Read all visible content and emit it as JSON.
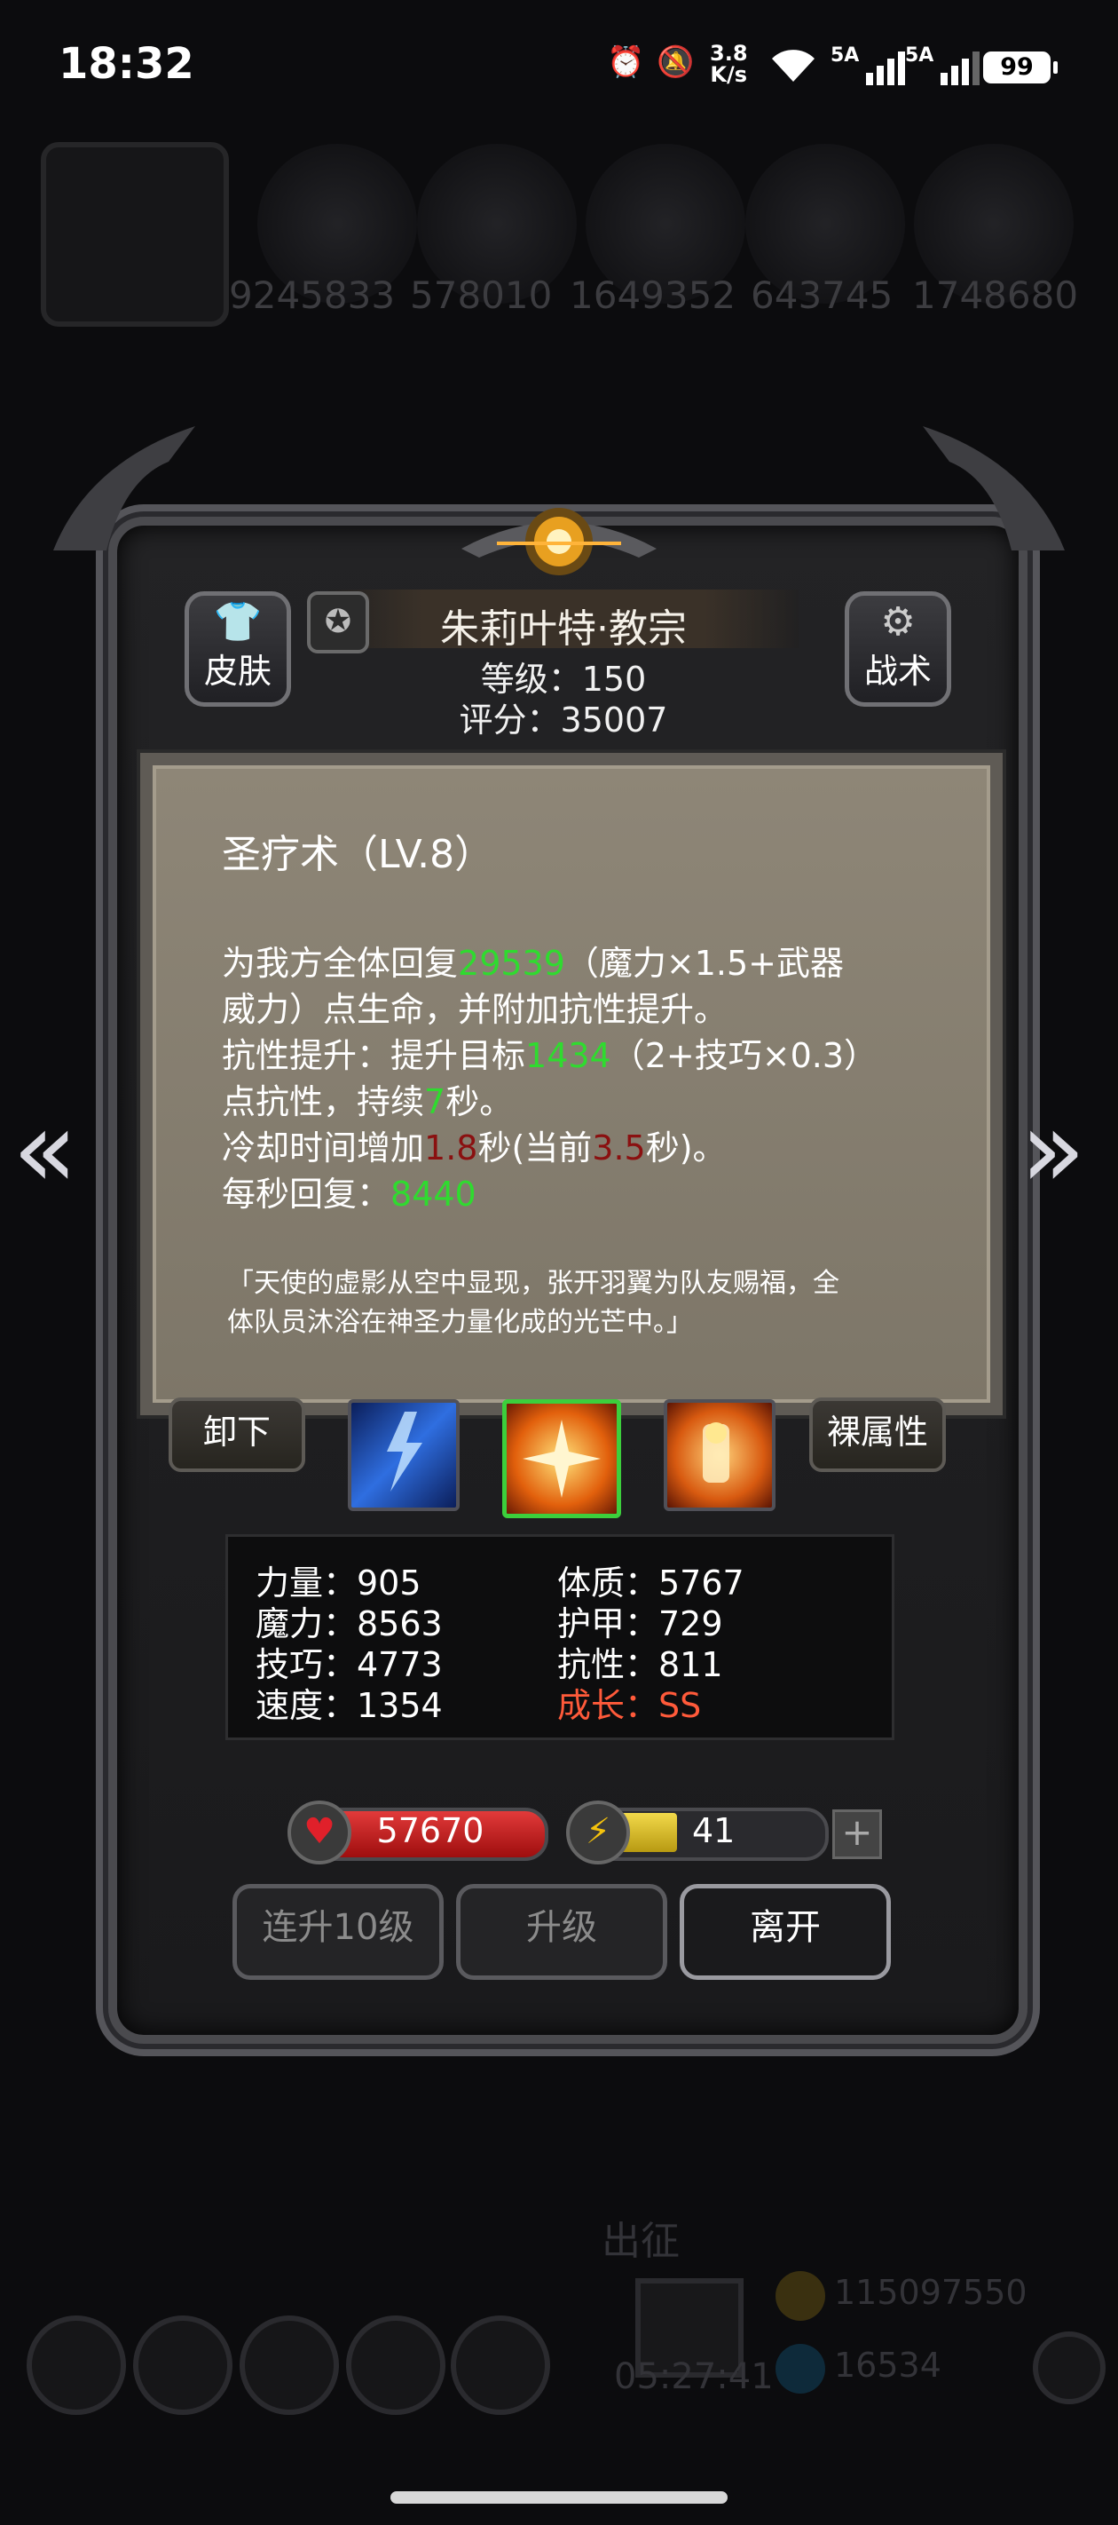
{
  "status_bar": {
    "time": "18:32",
    "net_speed_value": "3.8",
    "net_speed_unit": "K/s",
    "signal1": "5A",
    "signal2": "5A",
    "battery": "99",
    "icons": [
      "alarm-icon",
      "mute-icon",
      "wifi-icon",
      "signal-icon",
      "battery-icon"
    ]
  },
  "background": {
    "resource_numbers": [
      "9245833",
      "578010",
      "1649352",
      "643745",
      "1748680"
    ],
    "dim_labels": [
      "出征",
      "05:27:41",
      "115097550",
      "16534"
    ]
  },
  "hero": {
    "name": "朱莉叶特·教宗",
    "level_text": "等级：150",
    "score_text": "评分：35007",
    "skin_label": "皮肤",
    "tactics_label": "战术"
  },
  "skill": {
    "title": "圣疗术（LV.8）",
    "line1_a": "为我方全体回复",
    "line1_val": "29539",
    "line1_b": "（魔力×1.5+武器",
    "line2": "威力）点生命，并附加抗性提升。",
    "line3_a": "抗性提升：提升目标",
    "line3_val": "1434",
    "line3_b": "（2+技巧×0.3）",
    "line4_a": "点抗性，持续",
    "line4_val": "7",
    "line4_b": "秒。",
    "line5_a": "冷却时间增加",
    "line5_val": "1.8",
    "line5_b": "秒(当前",
    "line5_val2": "3.5",
    "line5_c": "秒)。",
    "line6_a": "每秒回复：",
    "line6_val": "8440",
    "quote1": "「天使的虚影从空中显现，张开羽翼为队友赐福，全",
    "quote2": "体队员沐浴在神圣力量化成的光芒中。」"
  },
  "skill_row": {
    "unequip_label": "卸下",
    "bare_attr_label": "裸属性"
  },
  "stats": {
    "strength": "力量：905",
    "magic": "魔力：8563",
    "skill": "技巧：4773",
    "speed": "速度：1354",
    "constitution": "体质：5767",
    "armor": "护甲：729",
    "resistance": "抗性：811",
    "growth": "成长：SS"
  },
  "bars": {
    "hp": "57670",
    "energy": "41",
    "energy_fraction": 0.41
  },
  "actions": {
    "level_up_10": "连升10级",
    "level_up": "升级",
    "leave": "离开"
  },
  "colors": {
    "highlight_green": "#2fdb2f",
    "highlight_red": "#8a1010",
    "growth_orange": "#ff5a3a"
  }
}
